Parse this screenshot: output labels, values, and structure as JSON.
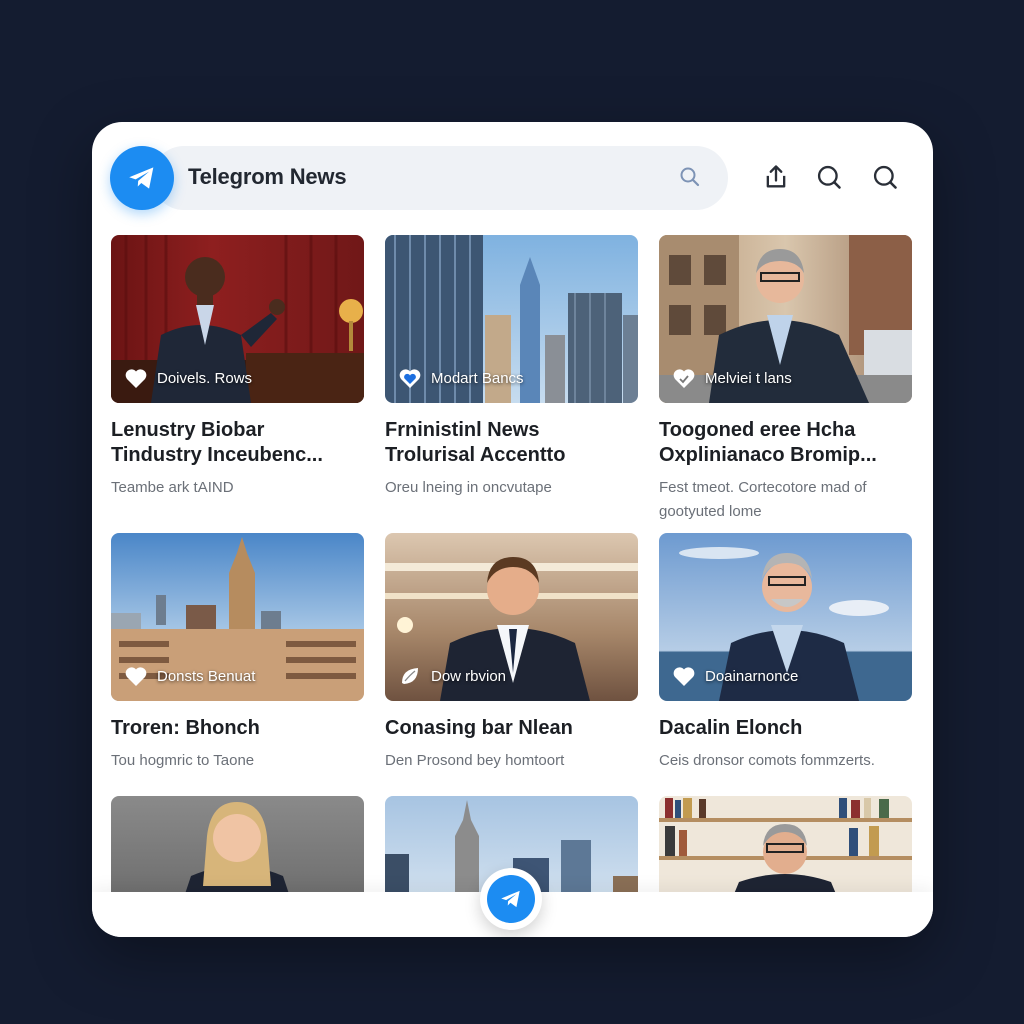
{
  "app": {
    "title": "Telegrom News"
  },
  "colors": {
    "accent": "#1c8cf2",
    "background": "#141c30",
    "card": "#ffffff"
  },
  "header": {
    "icons": [
      "telegram-logo-icon",
      "search-icon",
      "share-icon",
      "search-icon",
      "search-icon"
    ]
  },
  "cards": [
    {
      "overlay": "Doivels. Rows",
      "title_line1": "Lenustry Biobar",
      "title_line2": "Tindustry Inceubenc...",
      "subtitle": "Teambe ark tAIND",
      "badge_icon": "heart-icon"
    },
    {
      "overlay": "Modart Bancs",
      "title_line1": "Frninistinl News",
      "title_line2": "Trolurisal Accentto",
      "subtitle": "Oreu lneing in oncvutape",
      "badge_icon": "shield-heart-icon"
    },
    {
      "overlay": "Melviei t lans",
      "title_line1": "Toogoned eree Hcha",
      "title_line2": "Oxplinianaco Bromip...",
      "subtitle": "Fest tmeot. Cortecotore mad of gootyuted lome",
      "badge_icon": "heart-check-icon"
    },
    {
      "overlay": "Donsts Benuat",
      "title_line1": "Troren: Bhonch",
      "title_line2": "",
      "subtitle": "Tou hogmric to Taone",
      "badge_icon": "heart-icon"
    },
    {
      "overlay": "Dow rbvion",
      "title_line1": "Conasing bar Nlean",
      "title_line2": "",
      "subtitle": "Den Prosond bey homtoort",
      "badge_icon": "leaf-icon"
    },
    {
      "overlay": "Doainarnonce",
      "title_line1": "Dacalin Elonch",
      "title_line2": "",
      "subtitle": "Ceis dronsor comots fommzerts.",
      "badge_icon": "heart-icon"
    },
    {
      "overlay": "",
      "title_line1": "",
      "title_line2": "",
      "subtitle": "",
      "badge_icon": ""
    },
    {
      "overlay": "",
      "title_line1": "",
      "title_line2": "",
      "subtitle": "",
      "badge_icon": ""
    },
    {
      "overlay": "",
      "title_line1": "",
      "title_line2": "",
      "subtitle": "",
      "badge_icon": ""
    }
  ],
  "fab": {
    "icon": "telegram-send-icon"
  }
}
